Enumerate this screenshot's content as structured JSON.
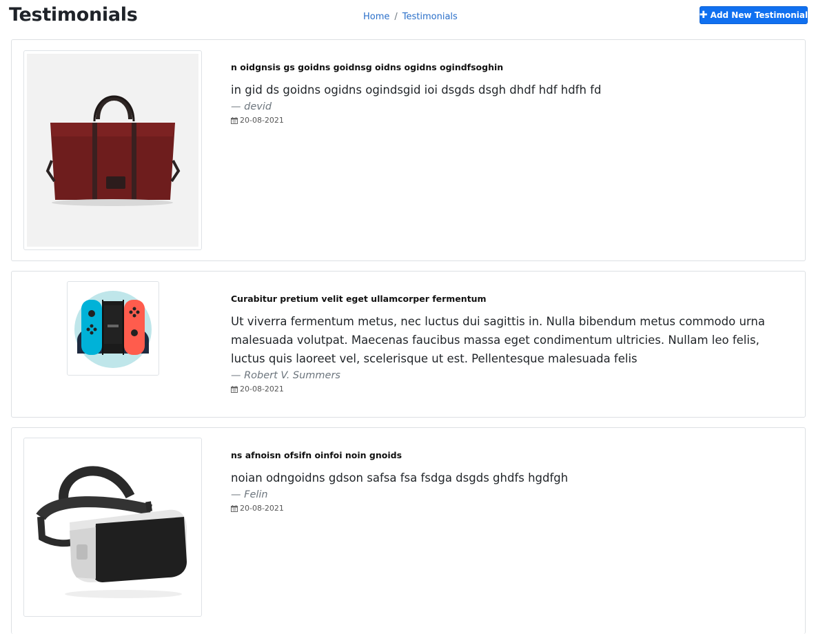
{
  "header": {
    "title": "Testimonials",
    "breadcrumb": {
      "home": "Home",
      "separator": "/",
      "current": "Testimonials"
    },
    "add_button": "Add New Testimonial",
    "add_button_icon": "plus-icon"
  },
  "colors": {
    "primary": "#1070f0",
    "link": "#2a6fc9",
    "muted": "#6c757d",
    "border": "#dcdfe3"
  },
  "testimonials": [
    {
      "image": "duffel-bag-image",
      "title": "n oidgnsis gs goidns goidnsg oidns ogidns ogindfsoghin",
      "body": "in gid ds goidns ogidns ogindsgid ioi dsgds dsgh dhdf hdf hdfh fd",
      "author": "— devid",
      "date": "20-08-2021",
      "date_icon": "calendar-icon"
    },
    {
      "image": "game-console-controller-image",
      "title": "Curabitur pretium velit eget ullamcorper fermentum",
      "body": "Ut viverra fermentum metus, nec luctus dui sagittis in. Nulla bibendum metus commodo urna malesuada volutpat. Maecenas faucibus massa eget condimentum ultricies. Nullam leo felis, luctus quis laoreet vel, scelerisque ut est. Pellentesque malesuada felis",
      "author": "— Robert V. Summers",
      "date": "20-08-2021",
      "date_icon": "calendar-icon"
    },
    {
      "image": "vr-headset-image",
      "title": "ns afnoisn ofsifn oinfoi noin gnoids",
      "body": "noian odngoidns gdson safsa fsa fsdga dsgds ghdfs hgdfgh",
      "author": "— Felin",
      "date": "20-08-2021",
      "date_icon": "calendar-icon"
    }
  ]
}
